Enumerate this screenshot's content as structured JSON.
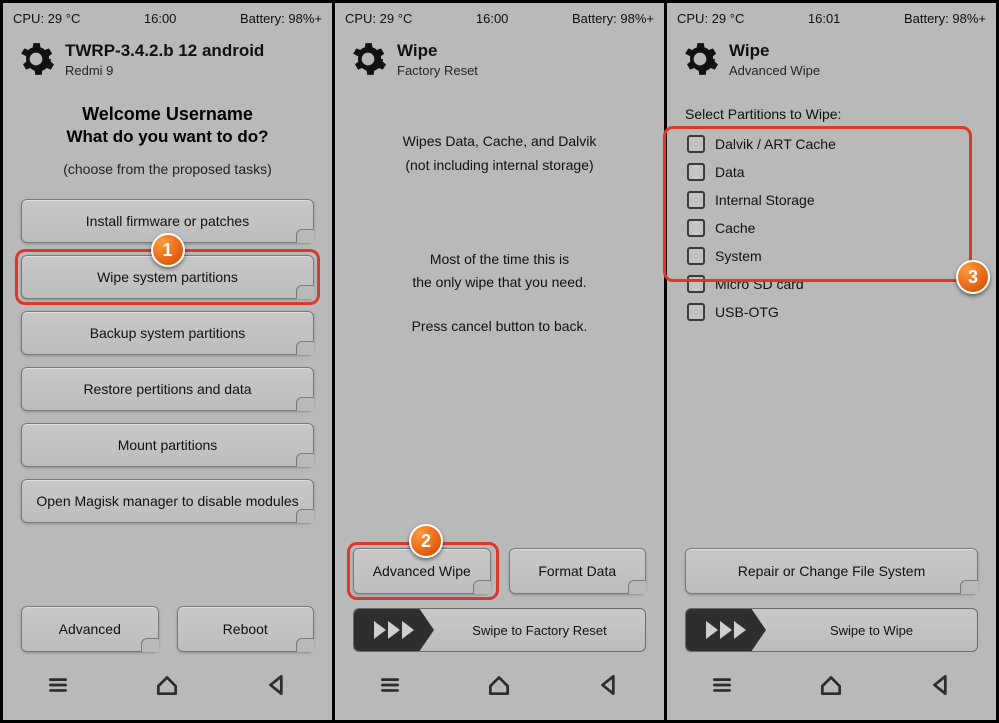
{
  "panel1": {
    "status": {
      "cpu": "CPU: 29 °C",
      "time": "16:00",
      "battery": "Battery: 98%+"
    },
    "header": {
      "title": "TWRP-3.4.2.b 12 android",
      "subtitle": "Redmi 9"
    },
    "welcome": {
      "line1": "Welcome Username",
      "line2": "What do you want to do?",
      "hint": "(choose from the proposed tasks)"
    },
    "buttons": [
      "Install firmware or patches",
      "Wipe system partitions",
      "Backup system partitions",
      "Restore pertitions and data",
      "Mount partitions",
      "Open Magisk manager to disable modules"
    ],
    "bottom": {
      "advanced": "Advanced",
      "reboot": "Reboot"
    },
    "callout": "1"
  },
  "panel2": {
    "status": {
      "cpu": "CPU: 29 °C",
      "time": "16:00",
      "battery": "Battery: 98%+"
    },
    "header": {
      "title": "Wipe",
      "subtitle": "Factory Reset"
    },
    "p1a": "Wipes Data, Cache, and Dalvik",
    "p1b": "(not including internal storage)",
    "p2a": "Most of the time this is",
    "p2b": "the only wipe that you need.",
    "p2c": "Press cancel button to back.",
    "adv": "Advanced Wipe",
    "format": "Format Data",
    "swipe": "Swipe to Factory Reset",
    "callout": "2"
  },
  "panel3": {
    "status": {
      "cpu": "CPU: 29 °C",
      "time": "16:01",
      "battery": "Battery: 98%+"
    },
    "header": {
      "title": "Wipe",
      "subtitle": "Advanced Wipe"
    },
    "section": "Select Partitions to Wipe:",
    "parts": [
      "Dalvik / ART Cache",
      "Data",
      "Internal Storage",
      "Cache",
      "System",
      "Micro SD card",
      "USB-OTG"
    ],
    "repair": "Repair or Change File System",
    "swipe": "Swipe to Wipe",
    "callout": "3"
  }
}
